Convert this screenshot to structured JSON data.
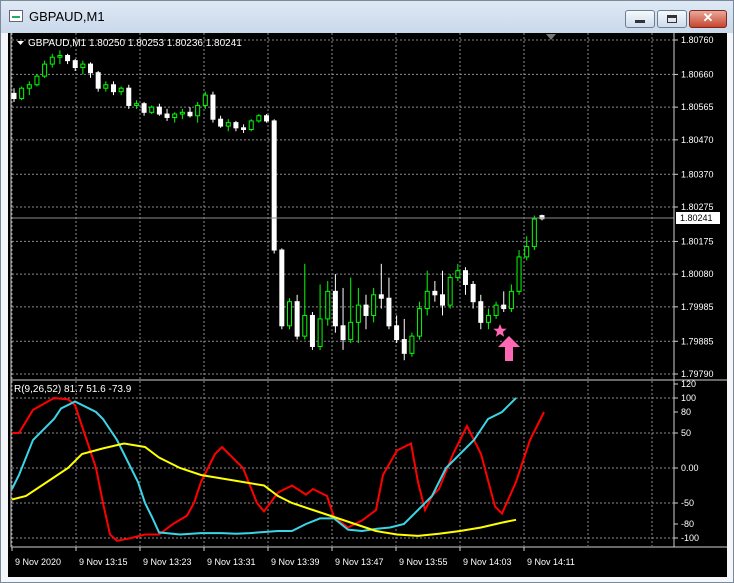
{
  "window": {
    "title": "GBPAUD,M1",
    "icon": "chart-window-icon",
    "minimize_icon": "minimize-icon",
    "maximize_icon": "maximize-icon",
    "close_icon": "close-icon",
    "close_glyph": "✕"
  },
  "price_chart": {
    "info": "GBPAUD,M1  1.80250 1.80253 1.80236 1.80241",
    "current_price": "1.80241",
    "price_labels": [
      "1.80760",
      "1.80660",
      "1.80565",
      "1.80470",
      "1.80370",
      "1.80275",
      "1.80175",
      "1.80080",
      "1.79985",
      "1.79885",
      "1.79790"
    ],
    "bull_color": "#00ff00",
    "bear_color": "#ffffff",
    "markers": {
      "star_icon": "pink-star-icon",
      "arrow_icon": "pink-up-arrow-icon",
      "color": "#ff69b4"
    }
  },
  "indicator": {
    "label": "R(9,26,52) 81.7 51.6 -73.9",
    "scale_labels": [
      "120",
      "100",
      "80",
      "50",
      "0.00",
      "-50",
      "-80",
      "-100"
    ],
    "colors": {
      "fast": "#ff0000",
      "mid": "#3ad6e8",
      "slow": "#ffff00"
    }
  },
  "time_axis": {
    "labels": [
      "9 Nov 2020",
      "9 Nov 13:15",
      "9 Nov 13:23",
      "9 Nov 13:31",
      "9 Nov 13:39",
      "9 Nov 13:47",
      "9 Nov 13:55",
      "9 Nov 14:03",
      "9 Nov 14:11"
    ]
  },
  "chart_data": {
    "type": "candlestick",
    "ylim": [
      1.7979,
      1.8076
    ],
    "candles": [
      [
        1.80605,
        1.8062,
        1.8058,
        1.8059
      ],
      [
        1.8059,
        1.80625,
        1.80585,
        1.8062
      ],
      [
        1.8062,
        1.8064,
        1.806,
        1.8063
      ],
      [
        1.8063,
        1.8066,
        1.80625,
        1.80655
      ],
      [
        1.80655,
        1.807,
        1.8065,
        1.8069
      ],
      [
        1.8069,
        1.8072,
        1.8068,
        1.8071
      ],
      [
        1.8071,
        1.8073,
        1.8069,
        1.80715
      ],
      [
        1.80715,
        1.8072,
        1.8069,
        1.807
      ],
      [
        1.807,
        1.80705,
        1.8067,
        1.8068
      ],
      [
        1.8068,
        1.807,
        1.8066,
        1.8069
      ],
      [
        1.8069,
        1.80695,
        1.8065,
        1.80665
      ],
      [
        1.80665,
        1.8067,
        1.8061,
        1.8062
      ],
      [
        1.8062,
        1.8064,
        1.8061,
        1.8063
      ],
      [
        1.8063,
        1.8064,
        1.806,
        1.8061
      ],
      [
        1.8061,
        1.80625,
        1.806,
        1.8062
      ],
      [
        1.8062,
        1.8063,
        1.8056,
        1.8057
      ],
      [
        1.8057,
        1.80585,
        1.8056,
        1.80575
      ],
      [
        1.80575,
        1.8058,
        1.8054,
        1.8055
      ],
      [
        1.8055,
        1.8057,
        1.80545,
        1.80565
      ],
      [
        1.80565,
        1.80575,
        1.8054,
        1.80545
      ],
      [
        1.80545,
        1.8056,
        1.80525,
        1.80535
      ],
      [
        1.80535,
        1.8055,
        1.8052,
        1.80545
      ],
      [
        1.80545,
        1.8056,
        1.8053,
        1.8055
      ],
      [
        1.8055,
        1.80565,
        1.80535,
        1.8054
      ],
      [
        1.8054,
        1.8058,
        1.8052,
        1.8057
      ],
      [
        1.8057,
        1.8061,
        1.8056,
        1.806
      ],
      [
        1.806,
        1.8061,
        1.8052,
        1.8053
      ],
      [
        1.8053,
        1.8054,
        1.80505,
        1.8051
      ],
      [
        1.8051,
        1.8053,
        1.80495,
        1.8052
      ],
      [
        1.8052,
        1.80525,
        1.80495,
        1.80505
      ],
      [
        1.80505,
        1.80515,
        1.8049,
        1.805
      ],
      [
        1.805,
        1.8053,
        1.80495,
        1.80525
      ],
      [
        1.80525,
        1.80545,
        1.8052,
        1.8054
      ],
      [
        1.8054,
        1.80545,
        1.8052,
        1.80525
      ],
      [
        1.80525,
        1.8053,
        1.8014,
        1.8015
      ],
      [
        1.8015,
        1.80155,
        1.7992,
        1.7993
      ],
      [
        1.7993,
        1.8001,
        1.7992,
        1.8
      ],
      [
        1.8,
        1.8002,
        1.7989,
        1.799
      ],
      [
        1.799,
        1.8011,
        1.7989,
        1.7996
      ],
      [
        1.7996,
        1.7997,
        1.7986,
        1.7987
      ],
      [
        1.7987,
        1.8005,
        1.7986,
        1.7995
      ],
      [
        1.7995,
        1.8006,
        1.7993,
        1.8003
      ],
      [
        1.8003,
        1.8008,
        1.7991,
        1.7993
      ],
      [
        1.7993,
        1.8004,
        1.7986,
        1.7989
      ],
      [
        1.7989,
        1.8007,
        1.7988,
        1.7994
      ],
      [
        1.7994,
        1.8004,
        1.7988,
        1.7999
      ],
      [
        1.7999,
        1.8002,
        1.7992,
        1.7996
      ],
      [
        1.7996,
        1.8004,
        1.7994,
        1.8002
      ],
      [
        1.8002,
        1.8011,
        1.7998,
        1.8001
      ],
      [
        1.8001,
        1.8007,
        1.7992,
        1.7993
      ],
      [
        1.7993,
        1.7996,
        1.7988,
        1.7989
      ],
      [
        1.7989,
        1.7995,
        1.7983,
        1.7985
      ],
      [
        1.7985,
        1.7991,
        1.7984,
        1.799
      ],
      [
        1.799,
        1.8,
        1.7989,
        1.7998
      ],
      [
        1.7998,
        1.8009,
        1.7996,
        1.8003
      ],
      [
        1.8003,
        1.8006,
        1.8,
        1.8002
      ],
      [
        1.8002,
        1.8009,
        1.7996,
        1.7999
      ],
      [
        1.7999,
        1.8008,
        1.7998,
        1.8007
      ],
      [
        1.8007,
        1.8011,
        1.8006,
        1.8009
      ],
      [
        1.8009,
        1.801,
        1.8002,
        1.8005
      ],
      [
        1.8005,
        1.8006,
        1.7998,
        1.8
      ],
      [
        1.8,
        1.8002,
        1.7992,
        1.7994
      ],
      [
        1.7994,
        1.7998,
        1.7992,
        1.7996
      ],
      [
        1.7996,
        1.8,
        1.7995,
        1.7999
      ],
      [
        1.7999,
        1.8003,
        1.7997,
        1.7998
      ],
      [
        1.7998,
        1.8005,
        1.7997,
        1.8003
      ],
      [
        1.8003,
        1.8015,
        1.8002,
        1.8013
      ],
      [
        1.8013,
        1.8019,
        1.8012,
        1.8016
      ],
      [
        1.8016,
        1.8025,
        1.8015,
        1.8024
      ],
      [
        1.8025,
        1.80253,
        1.80236,
        1.80241
      ]
    ],
    "oscillator": {
      "ylim": [
        -110,
        120
      ],
      "x_count": 70,
      "series": [
        {
          "color_key": "fast",
          "points": [
            [
              0,
              50
            ],
            [
              1,
              50
            ],
            [
              3,
              83
            ],
            [
              6,
              100
            ],
            [
              8,
              98
            ],
            [
              9,
              90
            ],
            [
              11,
              30
            ],
            [
              12,
              0
            ],
            [
              13,
              -50
            ],
            [
              14,
              -95
            ],
            [
              15,
              -104
            ],
            [
              17,
              -100
            ],
            [
              19,
              -95
            ],
            [
              21,
              -95
            ],
            [
              23,
              -80
            ],
            [
              25,
              -68
            ],
            [
              26,
              -50
            ],
            [
              27,
              -20
            ],
            [
              29,
              20
            ],
            [
              30,
              30
            ],
            [
              33,
              0
            ],
            [
              35,
              -50
            ],
            [
              36,
              -62
            ],
            [
              38,
              -35
            ],
            [
              40,
              -25
            ],
            [
              42,
              -38
            ],
            [
              43,
              -30
            ],
            [
              45,
              -40
            ],
            [
              46,
              -70
            ],
            [
              48,
              -85
            ],
            [
              50,
              -75
            ],
            [
              52,
              -60
            ],
            [
              53,
              -10
            ],
            [
              55,
              25
            ],
            [
              57,
              35
            ],
            [
              58,
              -20
            ],
            [
              59,
              -60
            ],
            [
              60,
              -40
            ],
            [
              61,
              -30
            ],
            [
              63,
              20
            ],
            [
              65,
              60
            ],
            [
              67,
              20
            ],
            [
              69,
              -55
            ],
            [
              70,
              -65
            ],
            [
              72,
              -20
            ],
            [
              74,
              40
            ],
            [
              76,
              80
            ]
          ]
        },
        {
          "color_key": "mid",
          "points": [
            [
              0,
              -30
            ],
            [
              1,
              -10
            ],
            [
              3,
              40
            ],
            [
              6,
              70
            ],
            [
              7,
              85
            ],
            [
              9,
              95
            ],
            [
              12,
              80
            ],
            [
              13,
              70
            ],
            [
              15,
              40
            ],
            [
              16,
              20
            ],
            [
              18,
              -20
            ],
            [
              19,
              -50
            ],
            [
              20,
              -70
            ],
            [
              21,
              -92
            ],
            [
              24,
              -95
            ],
            [
              27,
              -93
            ],
            [
              30,
              -93
            ],
            [
              32,
              -94
            ],
            [
              34,
              -93
            ],
            [
              38,
              -90
            ],
            [
              40,
              -90
            ],
            [
              42,
              -80
            ],
            [
              44,
              -72
            ],
            [
              46,
              -72
            ],
            [
              48,
              -88
            ],
            [
              50,
              -90
            ],
            [
              52,
              -87
            ],
            [
              54,
              -85
            ],
            [
              56,
              -80
            ],
            [
              58,
              -60
            ],
            [
              60,
              -40
            ],
            [
              62,
              0
            ],
            [
              64,
              20
            ],
            [
              66,
              40
            ],
            [
              68,
              70
            ],
            [
              70,
              80
            ],
            [
              72,
              100
            ]
          ]
        },
        {
          "color_key": "slow",
          "points": [
            [
              0,
              -45
            ],
            [
              2,
              -40
            ],
            [
              5,
              -20
            ],
            [
              8,
              0
            ],
            [
              10,
              20
            ],
            [
              13,
              28
            ],
            [
              16,
              35
            ],
            [
              19,
              30
            ],
            [
              21,
              15
            ],
            [
              24,
              0
            ],
            [
              27,
              -10
            ],
            [
              30,
              -15
            ],
            [
              33,
              -20
            ],
            [
              36,
              -25
            ],
            [
              38,
              -40
            ],
            [
              40,
              -50
            ],
            [
              43,
              -60
            ],
            [
              46,
              -70
            ],
            [
              49,
              -80
            ],
            [
              52,
              -90
            ],
            [
              55,
              -95
            ],
            [
              58,
              -97
            ],
            [
              61,
              -94
            ],
            [
              64,
              -90
            ],
            [
              67,
              -85
            ],
            [
              70,
              -78
            ],
            [
              72,
              -74
            ]
          ]
        }
      ]
    }
  }
}
